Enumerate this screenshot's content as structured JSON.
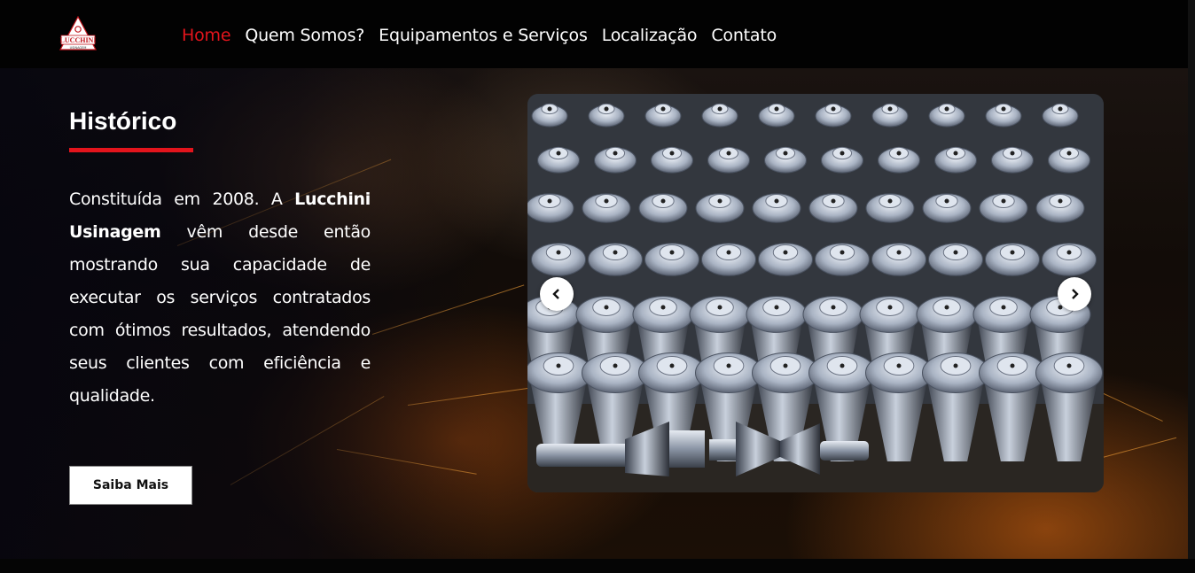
{
  "brand": {
    "logo_text": "LUCCHINI",
    "logo_subtext": "USINAGEM",
    "accent_color": "#e3141c"
  },
  "nav": {
    "items": [
      {
        "label": "Home",
        "active": true
      },
      {
        "label": "Quem Somos?",
        "active": false
      },
      {
        "label": "Equipamentos e Serviços",
        "active": false
      },
      {
        "label": "Localização",
        "active": false
      },
      {
        "label": "Contato",
        "active": false
      }
    ]
  },
  "section": {
    "title": "Histórico",
    "desc_part1": "Constituída em 2008. A ",
    "desc_bold": "Lucchini Usinagem",
    "desc_part2": " vêm desde então mostrando sua capacidade de executar os serviços contratados com ótimos resultados, atendendo seus clientes com eficiência e qualidade.",
    "button_label": "Saiba Mais"
  },
  "carousel": {
    "prev_icon": "chevron-left-icon",
    "next_icon": "chevron-right-icon"
  }
}
